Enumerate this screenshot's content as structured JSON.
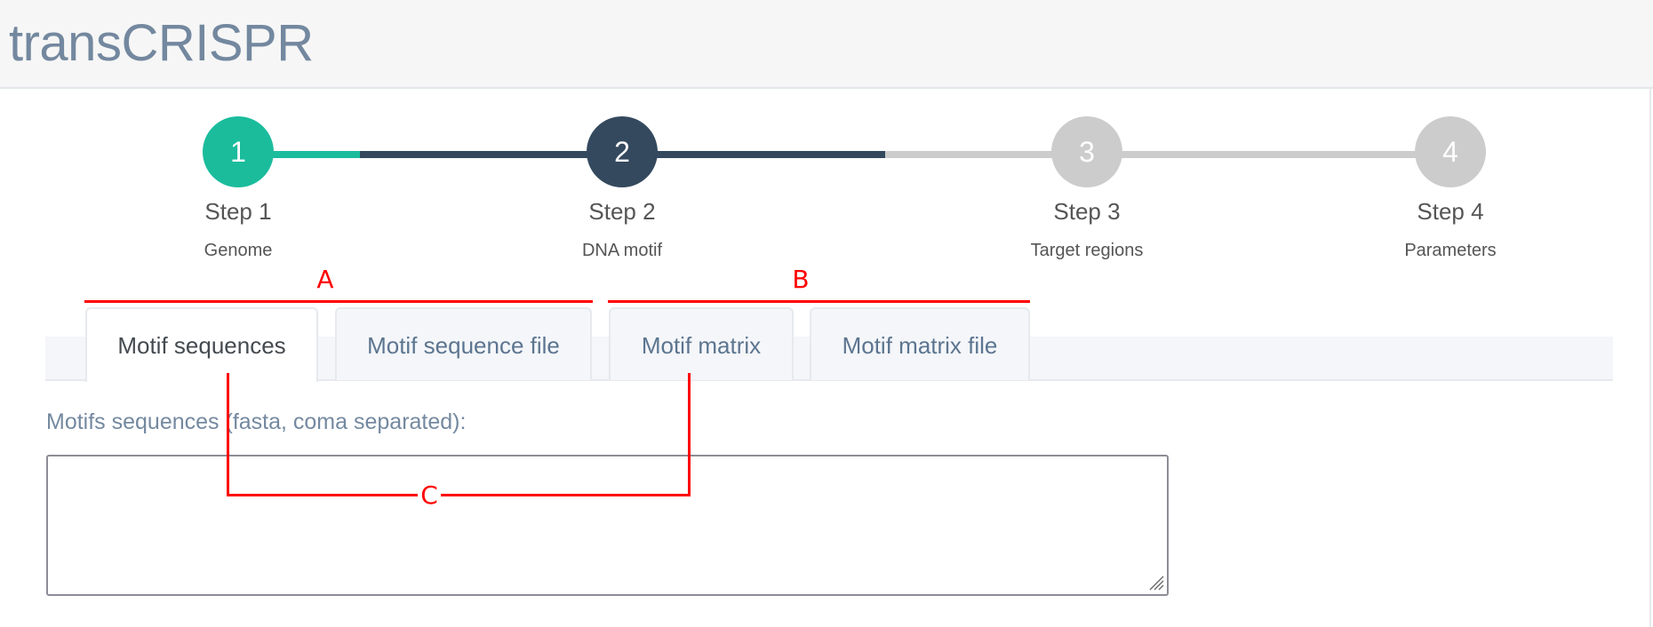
{
  "header": {
    "title": "transCRISPR"
  },
  "wizard": {
    "colors": {
      "completed": "#1abc9c",
      "current": "#34495e",
      "pending": "#cccccc"
    },
    "steps": [
      {
        "number": "1",
        "title": "Step 1",
        "description": "Genome",
        "state": "completed"
      },
      {
        "number": "2",
        "title": "Step 2",
        "description": "DNA motif",
        "state": "current"
      },
      {
        "number": "3",
        "title": "Step 3",
        "description": "Target regions",
        "state": "pending"
      },
      {
        "number": "4",
        "title": "Step 4",
        "description": "Parameters",
        "state": "pending"
      }
    ]
  },
  "tabs": [
    {
      "label": "Motif sequences",
      "active": true
    },
    {
      "label": "Motif sequence file",
      "active": false
    },
    {
      "label": "Motif matrix",
      "active": false
    },
    {
      "label": "Motif matrix file",
      "active": false
    }
  ],
  "form": {
    "label": "Motifs sequences (fasta, coma separated):",
    "value": "",
    "placeholder": ""
  },
  "annotations": {
    "color": "#ff0000",
    "group_a": "A",
    "group_b": "B",
    "connector": "C"
  }
}
